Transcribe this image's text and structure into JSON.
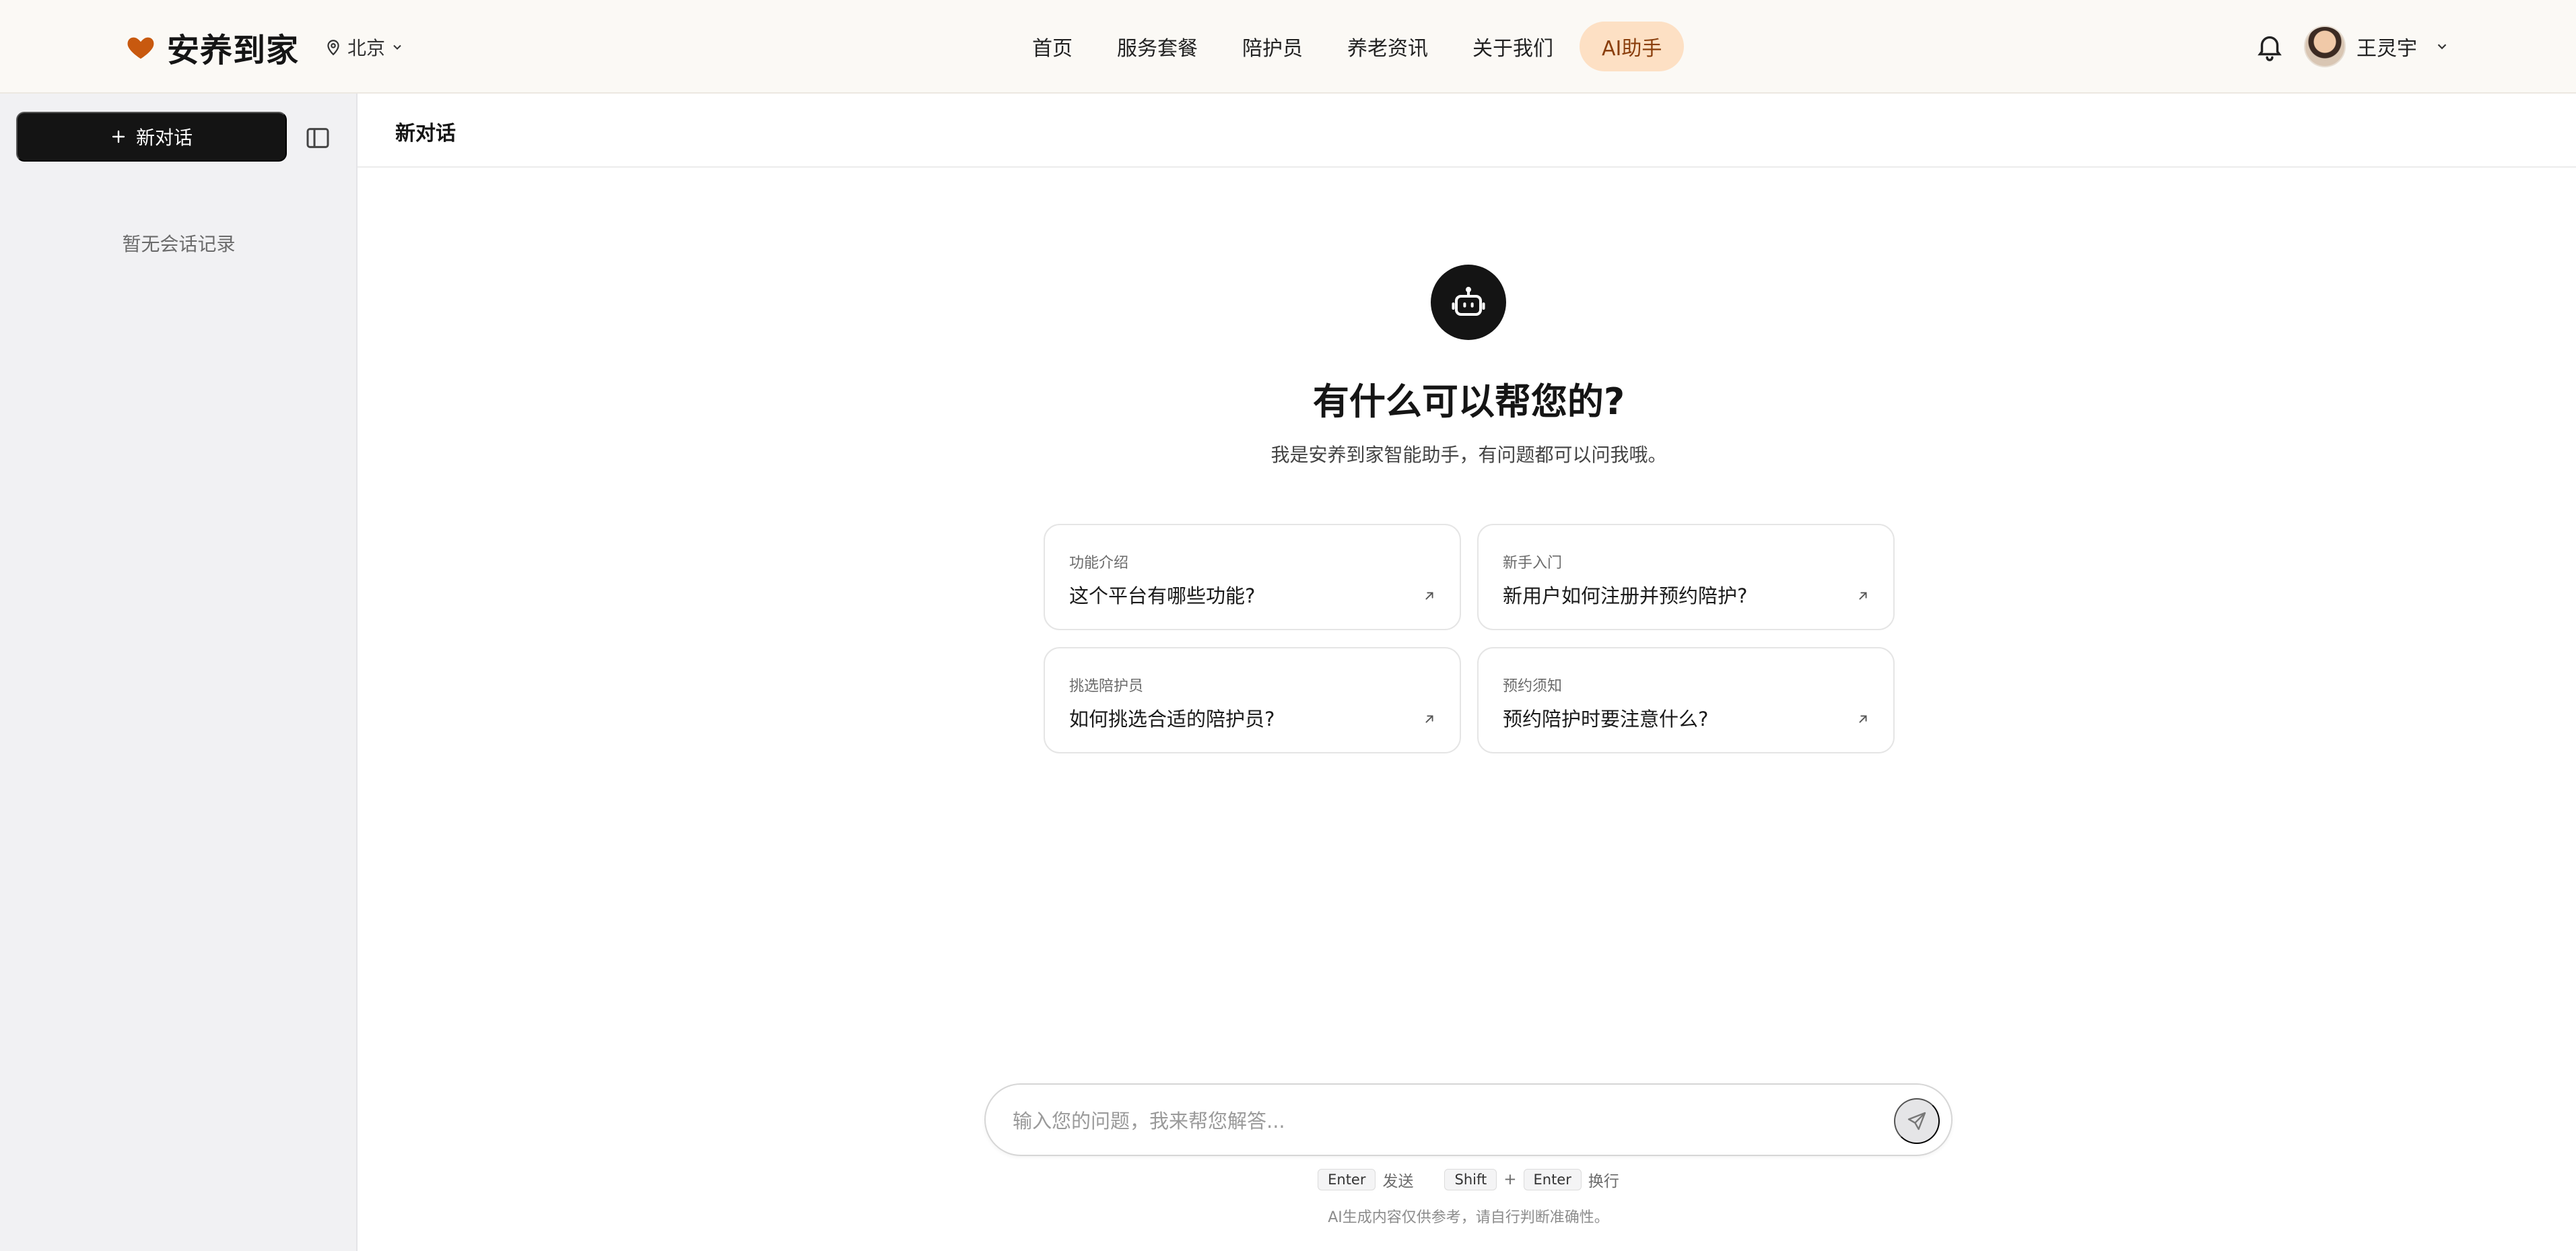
{
  "header": {
    "brand": "安养到家",
    "city": "北京",
    "nav": [
      "首页",
      "服务套餐",
      "陪护员",
      "养老资讯",
      "关于我们",
      "AI助手"
    ],
    "active_nav": "AI助手",
    "user_name": "王灵宇"
  },
  "sidebar": {
    "new_chat_label": "新对话",
    "empty_text": "暂无会话记录"
  },
  "main": {
    "title": "新对话",
    "hero_title": "有什么可以帮您的?",
    "hero_subtitle": "我是安养到家智能助手，有问题都可以问我哦。",
    "suggestions": [
      {
        "label": "功能介绍",
        "text": "这个平台有哪些功能?"
      },
      {
        "label": "新手入门",
        "text": "新用户如何注册并预约陪护?"
      },
      {
        "label": "挑选陪护员",
        "text": "如何挑选合适的陪护员?"
      },
      {
        "label": "预约须知",
        "text": "预约陪护时要注意什么?"
      }
    ],
    "input": {
      "value": "",
      "placeholder": "输入您的问题，我来帮您解答..."
    },
    "hints": {
      "enter_key": "Enter",
      "send_text": "发送",
      "shift_key": "Shift",
      "plus": "+",
      "enter_key_2": "Enter",
      "newline_text": "换行"
    },
    "disclaimer": "AI生成内容仅供参考，请自行判断准确性。"
  },
  "colors": {
    "brand_heart": "#c8590f",
    "active_nav_bg": "#fde0c4",
    "primary_dark": "#141414"
  },
  "icons": {
    "brand": "heart-icon",
    "city": "location-pin-icon",
    "notifications": "bell-icon",
    "toggle": "sidebar-panel-icon",
    "new_chat": "plus-icon",
    "assistant": "robot-icon",
    "card_arrow": "arrow-up-right-icon",
    "send": "send-icon"
  }
}
